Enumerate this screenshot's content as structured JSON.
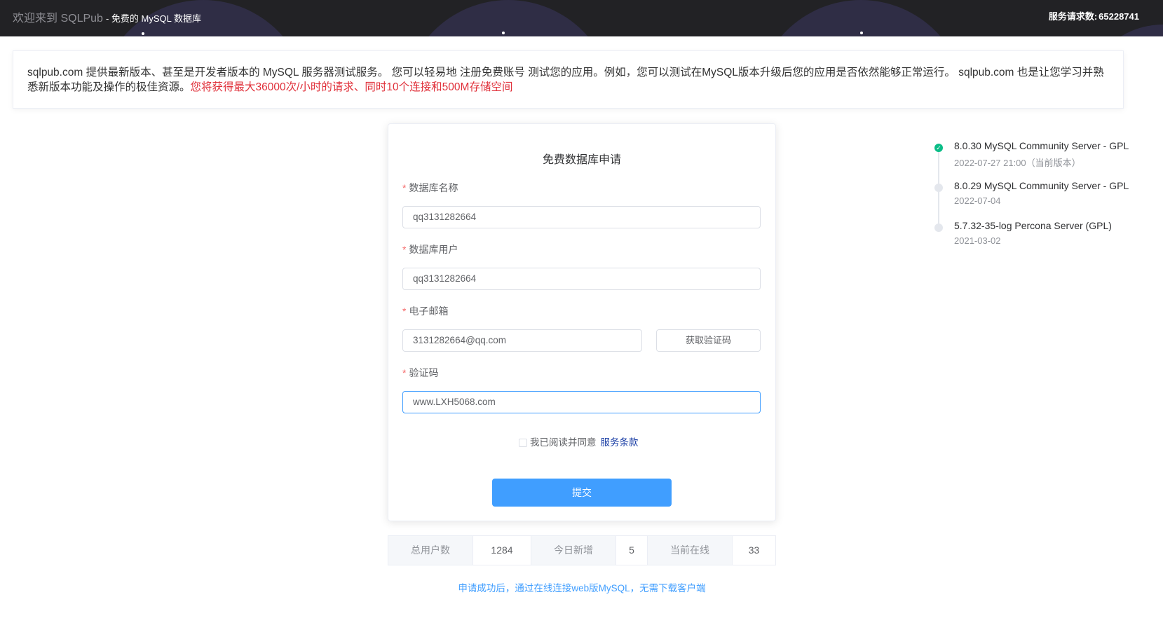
{
  "header": {
    "brand": "欢迎来到 SQLPub",
    "brand_sub": "- 免费的 MySQL 数据库",
    "request_count_label": "服务请求数:",
    "request_count": "65228741"
  },
  "intro": {
    "text": "sqlpub.com 提供最新版本、甚至是开发者版本的 MySQL 服务器测试服务。 您可以轻易地 注册免费账号 测试您的应用。例如，您可以测试在MySQL版本升级后您的应用是否依然能够正常运行。 sqlpub.com 也是让您学习并熟悉新版本功能及操作的极佳资源。",
    "highlight": "您将获得最大36000次/小时的请求、同时10个连接和500M存储空间"
  },
  "form": {
    "title": "免费数据库申请",
    "db_name_label": "数据库名称",
    "db_name_value": "qq3131282664",
    "db_user_label": "数据库用户",
    "db_user_value": "qq3131282664",
    "email_label": "电子邮箱",
    "email_value": "3131282664@qq.com",
    "get_code_button": "获取验证码",
    "code_label": "验证码",
    "code_value": "www.LXH5068.com",
    "agree_text": "我已阅读并同意",
    "terms_link": "服务条款",
    "agree_checked": false,
    "submit_button": "提交"
  },
  "stats": {
    "total_users_label": "总用户数",
    "total_users": "1284",
    "new_today_label": "今日新增",
    "new_today": "5",
    "online_label": "当前在线",
    "online": "33"
  },
  "footer_link": "申请成功后，通过在线连接web版MySQL，无需下载客户端",
  "timeline": [
    {
      "title": "8.0.30 MySQL Community Server - GPL",
      "date": "2022-07-27 21:00（当前版本）",
      "status": "current"
    },
    {
      "title": "8.0.29 MySQL Community Server - GPL",
      "date": "2022-07-04",
      "status": "past"
    },
    {
      "title": "5.7.32-35-log Percona Server (GPL)",
      "date": "2021-03-02",
      "status": "past"
    }
  ],
  "colors": {
    "header_bg": "#222225",
    "primary": "#409eff",
    "highlight_red": "#e0303a",
    "timeline_done": "#0bbd87"
  }
}
